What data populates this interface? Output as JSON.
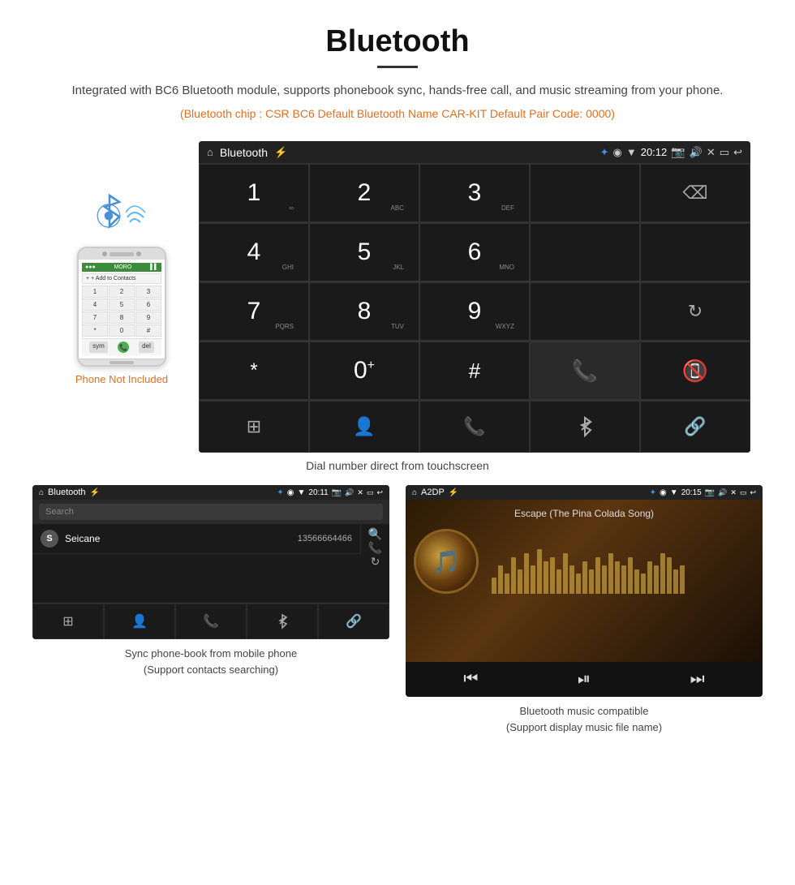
{
  "header": {
    "title": "Bluetooth",
    "description": "Integrated with BC6 Bluetooth module, supports phonebook sync, hands-free call, and music streaming from your phone.",
    "specs": "(Bluetooth chip : CSR BC6    Default Bluetooth Name CAR-KIT    Default Pair Code: 0000)"
  },
  "phone": {
    "not_included_label": "Phone Not Included",
    "status_bar": "MORO",
    "contact_btn": "+ Add to Contacts",
    "keys": [
      "1",
      "2",
      "3",
      "4",
      "5",
      "6",
      "7",
      "8",
      "9",
      "*",
      "0",
      "#"
    ],
    "bottom_labels": [
      "",
      "",
      ""
    ]
  },
  "dial_screen": {
    "status": {
      "title": "Bluetooth",
      "time": "20:12",
      "usb_icon": "⚡",
      "bt_icon": "✦",
      "gps_icon": "◉",
      "wifi_icon": "▼"
    },
    "keys": [
      {
        "num": "1",
        "sub": "∞"
      },
      {
        "num": "2",
        "sub": "ABC"
      },
      {
        "num": "3",
        "sub": "DEF"
      },
      {
        "num": "",
        "sub": ""
      },
      {
        "num": "⌫",
        "sub": ""
      }
    ],
    "keys_row2": [
      {
        "num": "4",
        "sub": "GHI"
      },
      {
        "num": "5",
        "sub": "JKL"
      },
      {
        "num": "6",
        "sub": "MNO"
      },
      {
        "num": "",
        "sub": ""
      },
      {
        "num": "",
        "sub": ""
      }
    ],
    "keys_row3": [
      {
        "num": "7",
        "sub": "PQRS"
      },
      {
        "num": "8",
        "sub": "TUV"
      },
      {
        "num": "9",
        "sub": "WXYZ"
      },
      {
        "num": "",
        "sub": ""
      },
      {
        "num": "↻",
        "sub": ""
      }
    ],
    "keys_row4": [
      {
        "num": "*",
        "sub": ""
      },
      {
        "num": "0+",
        "sub": ""
      },
      {
        "num": "#",
        "sub": ""
      },
      {
        "num": "📞",
        "sub": ""
      },
      {
        "num": "📵",
        "sub": ""
      }
    ],
    "bottom_icons": [
      "⊞",
      "👤",
      "📞",
      "✦",
      "🔗"
    ],
    "caption": "Dial number direct from touchscreen"
  },
  "phonebook_screen": {
    "status": {
      "title": "Bluetooth",
      "time": "20:11"
    },
    "search_placeholder": "Search",
    "contacts": [
      {
        "initial": "S",
        "name": "Seicane",
        "number": "13566664466"
      }
    ],
    "side_icons": [
      "🔍",
      "📞",
      "↻"
    ],
    "bottom_icons": [
      "⊞",
      "👤",
      "📞",
      "✦",
      "🔗"
    ],
    "caption_line1": "Sync phone-book from mobile phone",
    "caption_line2": "(Support contacts searching)"
  },
  "music_screen": {
    "status": {
      "title": "A2DP",
      "time": "20:15"
    },
    "song_title": "Escape (The Pina Colada Song)",
    "waveform_heights": [
      20,
      35,
      25,
      45,
      30,
      50,
      35,
      55,
      40,
      45,
      30,
      50,
      35,
      25,
      40,
      30,
      45,
      35,
      50,
      40,
      35,
      45,
      30,
      25,
      40,
      35,
      50,
      45,
      30,
      35
    ],
    "ctrl_icons": [
      "⏮",
      "⏯",
      "⏭"
    ],
    "caption_line1": "Bluetooth music compatible",
    "caption_line2": "(Support display music file name)"
  }
}
